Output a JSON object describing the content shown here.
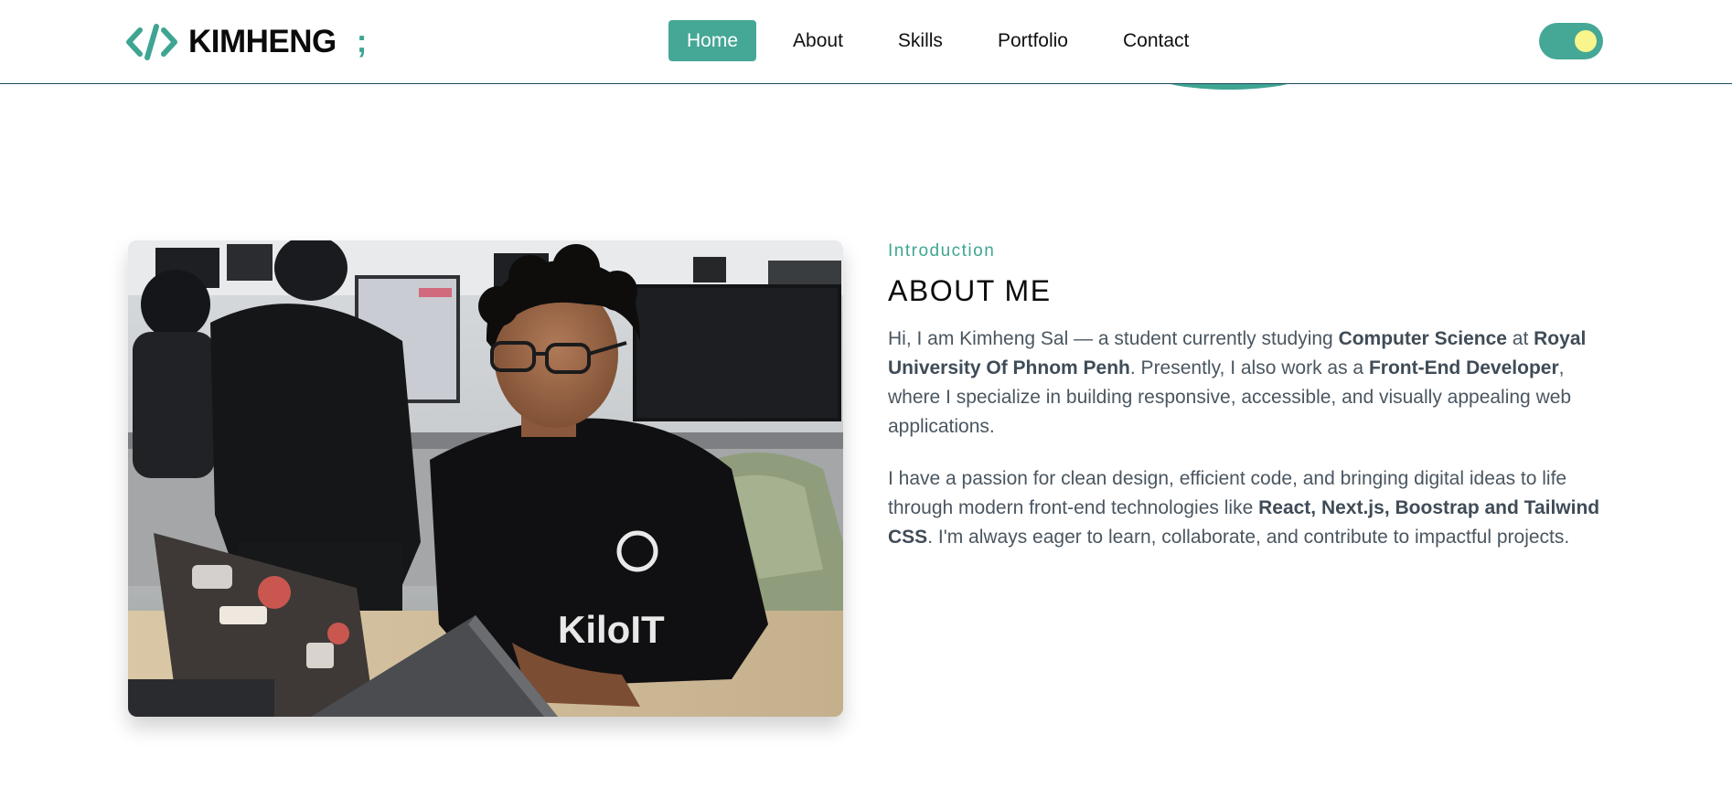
{
  "brand": {
    "name": "KIMHENG",
    "semicolon": ";",
    "icon": "code-brackets-icon",
    "accent_color": "#45a796"
  },
  "nav": {
    "items": [
      {
        "label": "Home",
        "active": true
      },
      {
        "label": "About",
        "active": false
      },
      {
        "label": "Skills",
        "active": false
      },
      {
        "label": "Portfolio",
        "active": false
      },
      {
        "label": "Contact",
        "active": false
      }
    ]
  },
  "theme_toggle": {
    "icon": "sun-icon",
    "track_color": "#45a796",
    "knob_color": "#f7f58c"
  },
  "about": {
    "image_icon": "person-at-laptop-photo",
    "intro_label": "Introduction",
    "title": "ABOUT ME",
    "paragraph1": {
      "t1": "Hi, I am Kimheng Sal — a student currently studying ",
      "b1": "Computer Science",
      "t2": " at ",
      "b2": "Royal University Of Phnom Penh",
      "t3": ". Presently, I also work as a ",
      "b3": "Front-End Developer",
      "t4": ", where I specialize in building responsive, accessible, and visually appealing web applications."
    },
    "paragraph2": {
      "t1": "I have a passion for clean design, efficient code, and bringing digital ideas to life through modern front-end technologies like ",
      "b1": "React, Next.js, Boostrap and Tailwind CSS",
      "t2": ". I'm always eager to learn, collaborate, and contribute to impactful projects."
    },
    "shirt_text": "KiloIT"
  }
}
